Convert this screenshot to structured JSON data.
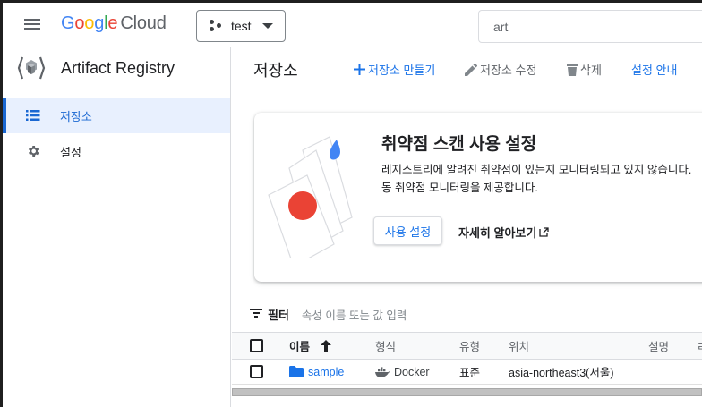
{
  "header": {
    "logo": {
      "g1": "G",
      "g2": "o",
      "g3": "o",
      "g4": "g",
      "g5": "l",
      "g6": "e",
      "cloud": "Cloud"
    },
    "project": "test",
    "search_value": "art"
  },
  "sidebar": {
    "product_title": "Artifact Registry",
    "items": [
      {
        "label": "저장소",
        "icon": "list-icon",
        "active": true
      },
      {
        "label": "설정",
        "icon": "gear-icon",
        "active": false
      }
    ]
  },
  "toolbar": {
    "title": "저장소",
    "create_label": "저장소 만들기",
    "edit_label": "저장소 수정",
    "delete_label": "삭제",
    "guide_label": "설정 안내"
  },
  "card": {
    "title": "취약점 스캔 사용 설정",
    "body_line1": "레지스트리에 알려진 취약점이 있는지 모니터링되고 있지 않습니다.",
    "body_line2": "동 취약점 모니터링을 제공합니다.",
    "enable_label": "사용 설정",
    "learn_label": "자세히 알아보기"
  },
  "filter": {
    "label": "필터",
    "placeholder": "속성 이름 또는 값 입력"
  },
  "table": {
    "columns": [
      "이름",
      "형식",
      "유형",
      "위치",
      "설명",
      "ㄹ"
    ],
    "rows": [
      {
        "name": "sample",
        "format": "Docker",
        "type": "표준",
        "location": "asia-northeast3(서울)",
        "description": ""
      }
    ]
  },
  "colors": {
    "accent": "#1a73e8",
    "active_bg": "#e8f0fe",
    "illus_red": "#ea4335",
    "illus_blue": "#4285f4"
  }
}
